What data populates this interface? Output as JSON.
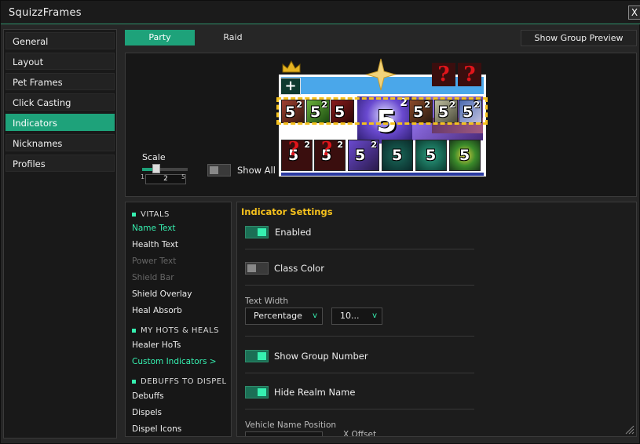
{
  "window": {
    "title": "SquizzFrames",
    "close_label": "X"
  },
  "nav": {
    "items": [
      {
        "label": "General",
        "active": false
      },
      {
        "label": "Layout",
        "active": false
      },
      {
        "label": "Pet Frames",
        "active": false
      },
      {
        "label": "Click Casting",
        "active": false
      },
      {
        "label": "Indicators",
        "active": true
      },
      {
        "label": "Nicknames",
        "active": false
      },
      {
        "label": "Profiles",
        "active": false
      }
    ]
  },
  "tabs": {
    "party": "Party",
    "raid": "Raid",
    "show_group_preview": "Show Group Preview"
  },
  "preview": {
    "scale_label": "Scale",
    "scale_value": "2",
    "scale_min": "1",
    "scale_max": "5",
    "show_all_label": "Show All",
    "plus_glyph": "+",
    "question_glyph": "?",
    "stack_number": "5",
    "stack_count": "2"
  },
  "indicator_list": {
    "vitals": {
      "header": "VITALS",
      "items": [
        "Name Text",
        "Health Text",
        "Power Text",
        "Shield Bar",
        "Shield Overlay",
        "Heal Absorb"
      ]
    },
    "hots": {
      "header": "MY HOTS & HEALS",
      "items": [
        "Healer HoTs",
        "Custom Indicators >"
      ]
    },
    "debuffs": {
      "header": "DEBUFFS TO DISPEL",
      "items": [
        "Debuffs",
        "Dispels",
        "Dispel Icons"
      ]
    }
  },
  "settings": {
    "title": "Indicator Settings",
    "enabled_label": "Enabled",
    "class_color_label": "Class Color",
    "text_width_label": "Text Width",
    "text_width_mode": "Percentage",
    "text_width_value": "10...",
    "chevron": "v",
    "show_group_number_label": "Show Group Number",
    "hide_realm_name_label": "Hide Realm Name",
    "vehicle_name_position_label": "Vehicle Name Position",
    "x_offset_label": "X Offset"
  },
  "colors": {
    "accent": "#1ea27a",
    "accent_bright": "#36f0b0",
    "gold": "#f5c11d",
    "health": "#4aa7ea"
  }
}
